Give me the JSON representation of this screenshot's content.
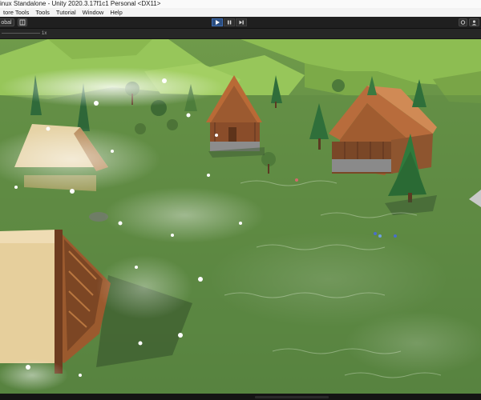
{
  "window": {
    "title": "inux Standalone - Unity 2020.3.17f1c1 Personal <DX11>"
  },
  "menu": {
    "items": [
      {
        "label": "tore Tools"
      },
      {
        "label": "Tools"
      },
      {
        "label": "Tutorial"
      },
      {
        "label": "Window"
      },
      {
        "label": "Help"
      }
    ]
  },
  "toolbar": {
    "pivot_label": "obal",
    "play_icon": "play-icon",
    "pause_icon": "pause-icon",
    "step_icon": "step-icon"
  },
  "game_view": {
    "scale_label": "1x"
  },
  "colors": {
    "play_active": "#2b4e80",
    "grass": "#6d9848",
    "hills": "#8cbf4f",
    "wood": "#9a5a2e",
    "thatch": "#d9c08a",
    "tree": "#2f6f3a",
    "shadow": "#3f5a35",
    "sparkle": "#ffffff"
  }
}
